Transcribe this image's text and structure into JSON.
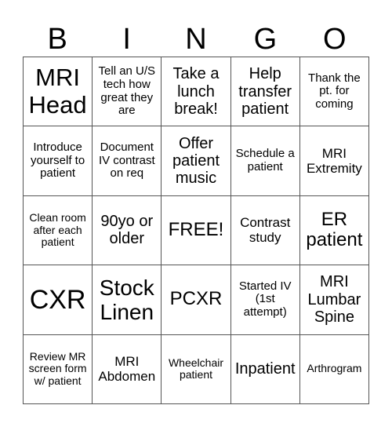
{
  "header": {
    "letters": [
      "B",
      "I",
      "N",
      "G",
      "O"
    ]
  },
  "board": {
    "cells": [
      [
        "MRI Head",
        "Tell an U/S tech how great they are",
        "Take a lunch break!",
        "Help transfer patient",
        "Thank the pt. for coming"
      ],
      [
        "Introduce yourself to patient",
        "Document IV contrast on req",
        "Offer patient music",
        "Schedule a patient",
        "MRI Extremity"
      ],
      [
        "Clean room after each patient",
        "90yo or older",
        "FREE!",
        "Contrast study",
        "ER patient"
      ],
      [
        "CXR",
        "Stock Linen",
        "PCXR",
        "Started IV (1st attempt)",
        "MRI Lumbar Spine"
      ],
      [
        "Review MR screen form w/ patient",
        "MRI Abdomen",
        "Wheelchair patient",
        "Inpatient",
        "Arthrogram"
      ]
    ]
  }
}
